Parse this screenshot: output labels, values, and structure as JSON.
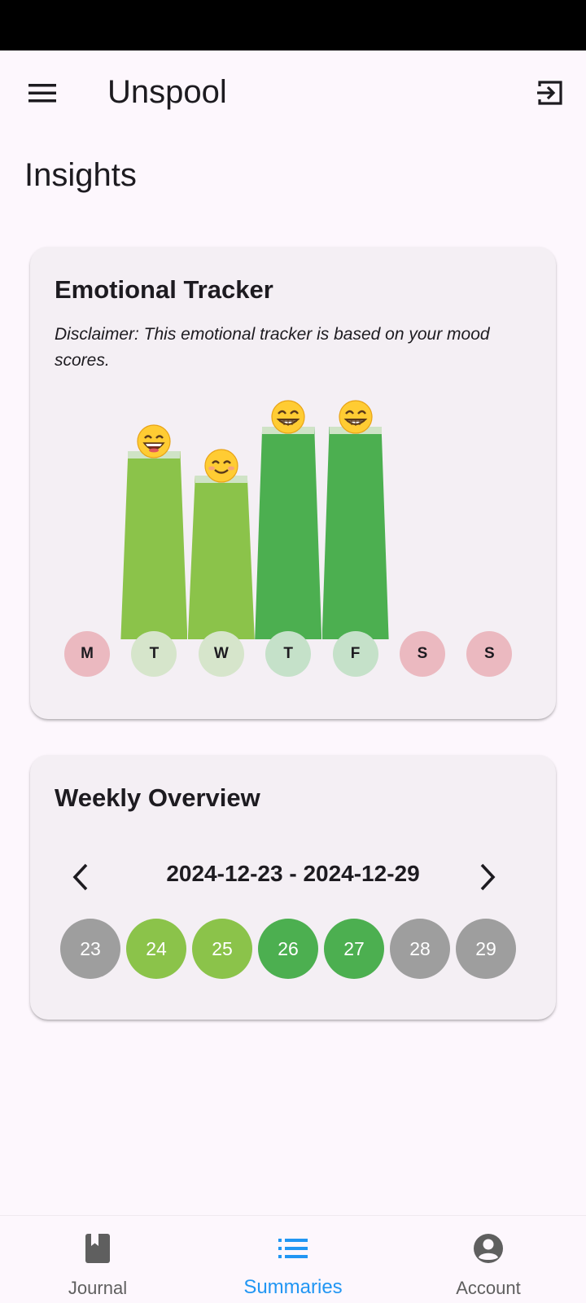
{
  "app_bar": {
    "title": "Unspool"
  },
  "page": {
    "title": "Insights"
  },
  "emotional_tracker": {
    "title": "Emotional Tracker",
    "disclaimer": "Disclaimer: This emotional tracker is based on your mood scores.",
    "days": [
      {
        "label": "M",
        "has_entry": false,
        "mood": null,
        "emoji": null,
        "bar_color": null,
        "circle_color": "#ebb9c0"
      },
      {
        "label": "T",
        "has_entry": true,
        "mood": 0.84,
        "emoji": "grinning-face-with-smiling-eyes",
        "bar_color": "#8bc34a",
        "circle_color": "#d6e5cb"
      },
      {
        "label": "W",
        "has_entry": true,
        "mood": 0.73,
        "emoji": "smiling-face-with-smiling-eyes",
        "bar_color": "#8bc34a",
        "circle_color": "#d6e5cb"
      },
      {
        "label": "T",
        "has_entry": true,
        "mood": 0.95,
        "emoji": "beaming-face-with-smiling-eyes",
        "bar_color": "#4caf50",
        "circle_color": "#c5e1c9"
      },
      {
        "label": "F",
        "has_entry": true,
        "mood": 0.95,
        "emoji": "beaming-face-with-smiling-eyes",
        "bar_color": "#4caf50",
        "circle_color": "#c5e1c9"
      },
      {
        "label": "S",
        "has_entry": false,
        "mood": null,
        "emoji": null,
        "bar_color": null,
        "circle_color": "#ebb9c0"
      },
      {
        "label": "S",
        "has_entry": false,
        "mood": null,
        "emoji": null,
        "bar_color": null,
        "circle_color": "#ebb9c0"
      }
    ]
  },
  "weekly_overview": {
    "title": "Weekly Overview",
    "date_range": "2024-12-23 - 2024-12-29",
    "dates": [
      {
        "day": "23",
        "color": "#9e9e9e"
      },
      {
        "day": "24",
        "color": "#8bc34a"
      },
      {
        "day": "25",
        "color": "#8bc34a"
      },
      {
        "day": "26",
        "color": "#4caf50"
      },
      {
        "day": "27",
        "color": "#4caf50"
      },
      {
        "day": "28",
        "color": "#9e9e9e"
      },
      {
        "day": "29",
        "color": "#9e9e9e"
      }
    ]
  },
  "bottom_nav": {
    "items": [
      {
        "label": "Journal",
        "icon": "book-icon",
        "active": false
      },
      {
        "label": "Summaries",
        "icon": "list-icon",
        "active": true
      },
      {
        "label": "Account",
        "icon": "account-circle-icon",
        "active": false
      }
    ]
  },
  "colors": {
    "background": "#fdf7fd",
    "card": "#f4eff4",
    "accent": "#2196f3"
  }
}
